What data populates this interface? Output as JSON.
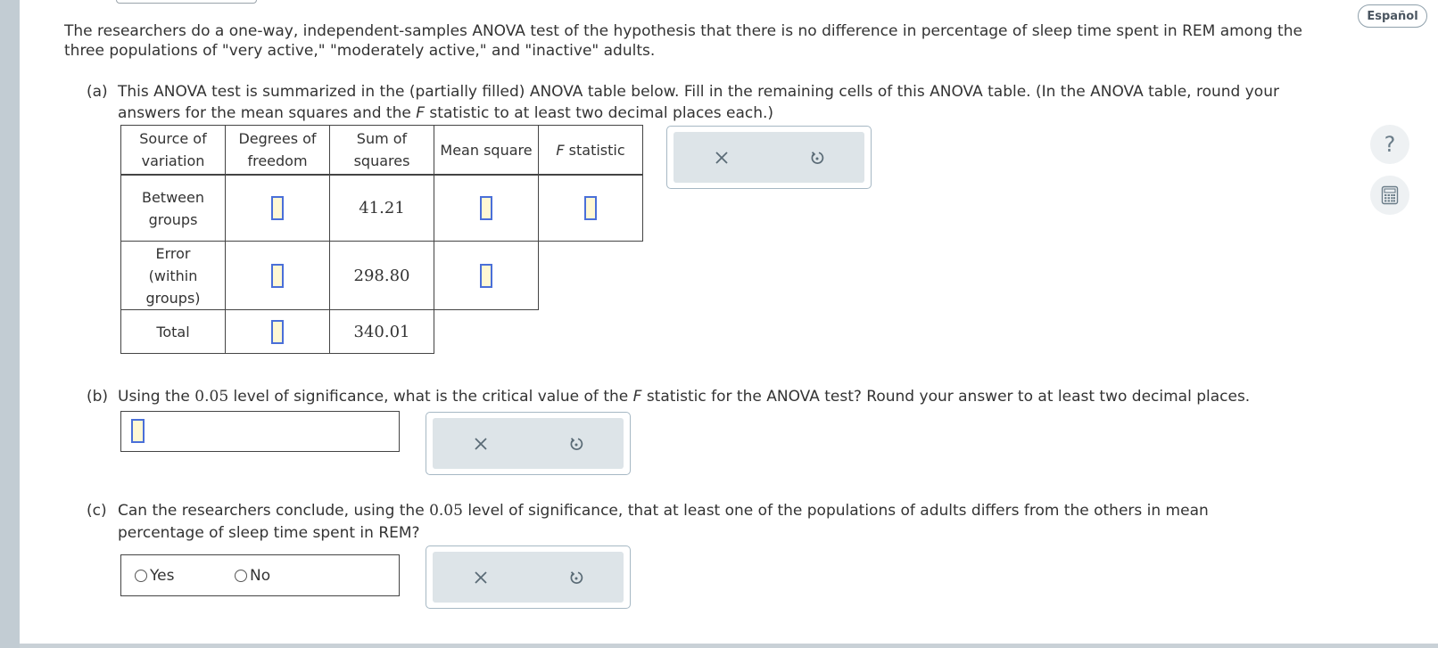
{
  "intro_text": "The researchers do a one-way, independent-samples ANOVA test of the hypothesis that there is no difference in percentage of sleep time spent in REM among the three populations of \"very active,\" \"moderately active,\" and \"inactive\" adults.",
  "part_a": {
    "label": "(a)",
    "text_1": "This ANOVA test is summarized in the (partially filled) ANOVA table below. Fill in the remaining cells of this ANOVA table. (In the ANOVA table, round your answers for the mean squares and the ",
    "f_italic": "F",
    "text_2": " statistic to at least two decimal places each.)"
  },
  "anova_table": {
    "headers": {
      "source_1": "Source of",
      "source_2": "variation",
      "df_1": "Degrees of",
      "df_2": "freedom",
      "ss_1": "Sum of",
      "ss_2": "squares",
      "ms": "Mean square",
      "f_italic": "F",
      "f_rest": " statistic"
    },
    "rows": [
      {
        "source_lines": [
          "Between",
          "groups"
        ],
        "sum_of_squares": "41.21"
      },
      {
        "source_lines": [
          "Error",
          "(within",
          "groups)"
        ],
        "sum_of_squares": "298.80"
      },
      {
        "source_lines": [
          "Total"
        ],
        "sum_of_squares": "340.01"
      }
    ]
  },
  "part_b": {
    "label": "(b)",
    "text_1": "Using the ",
    "alpha": "0.05",
    "text_2": " level of significance, what is the critical value of the ",
    "f_italic": "F",
    "text_3": " statistic for the ANOVA test? Round your answer to at least two decimal places."
  },
  "part_c": {
    "label": "(c)",
    "text_1": "Can the researchers conclude, using the ",
    "alpha": "0.05",
    "text_2": " level of significance, that at least one of the populations of adults differs from the others in mean percentage of sleep time spent in REM?",
    "options": [
      "Yes",
      "No"
    ]
  },
  "side": {
    "language_button": "Español",
    "help_label": "?"
  },
  "icons": {
    "clear": "close-icon",
    "reset": "undo-icon",
    "help": "question-icon",
    "calculator": "calculator-icon"
  }
}
